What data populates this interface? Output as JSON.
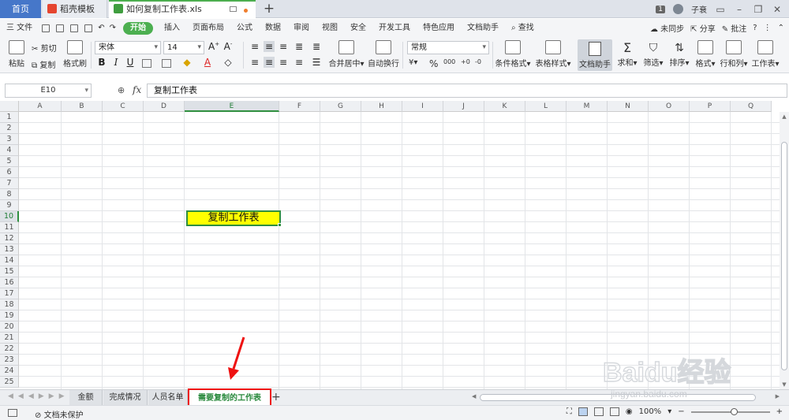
{
  "window": {
    "tabs": [
      {
        "label": "首页"
      },
      {
        "label": "稻壳模板"
      },
      {
        "label": "如何复制工作表.xls"
      }
    ],
    "badge": "1",
    "user": "子衰"
  },
  "menu": {
    "file": "三 文件",
    "items": [
      "开始",
      "插入",
      "页面布局",
      "公式",
      "数据",
      "审阅",
      "视图",
      "安全",
      "开发工具",
      "特色应用",
      "文档助手",
      "查找"
    ],
    "sync": "未同步",
    "share": "分享",
    "comment": "批注"
  },
  "ribbon": {
    "paste": "粘贴",
    "cut": "剪切",
    "copy": "复制",
    "format_painter": "格式刷",
    "font_name": "宋体",
    "font_size": "14",
    "merge_center": "合并居中",
    "auto_wrap": "自动换行",
    "number_format": "常规",
    "conditional_format": "条件格式",
    "table_style": "表格样式",
    "doc_assistant": "文档助手",
    "sum": "求和",
    "filter": "筛选",
    "sort": "排序",
    "format": "格式",
    "row_col": "行和列",
    "worksheet": "工作表"
  },
  "formula_bar": {
    "name_box": "E10",
    "fx": "fx",
    "value": "复制工作表"
  },
  "grid": {
    "columns": [
      "A",
      "B",
      "C",
      "D",
      "E",
      "F",
      "G",
      "H",
      "I",
      "J",
      "K",
      "L",
      "M",
      "N",
      "O",
      "P",
      "Q"
    ],
    "rows": [
      "1",
      "2",
      "3",
      "4",
      "5",
      "6",
      "7",
      "8",
      "9",
      "10",
      "11",
      "12",
      "13",
      "14",
      "15",
      "16",
      "17",
      "18",
      "19",
      "20",
      "21",
      "22",
      "23",
      "24",
      "25"
    ],
    "active_cell": "E10",
    "active_cell_value": "复制工作表",
    "active_fill": "#ffff00"
  },
  "sheets": [
    {
      "label": "金额"
    },
    {
      "label": "完成情况"
    },
    {
      "label": "人员名单"
    },
    {
      "label": "需要复制的工作表"
    }
  ],
  "status": {
    "protect": "文档未保护",
    "zoom": "100%"
  },
  "watermark": {
    "brand": "Baidu经验",
    "url": "jingyan.baidu.com"
  }
}
